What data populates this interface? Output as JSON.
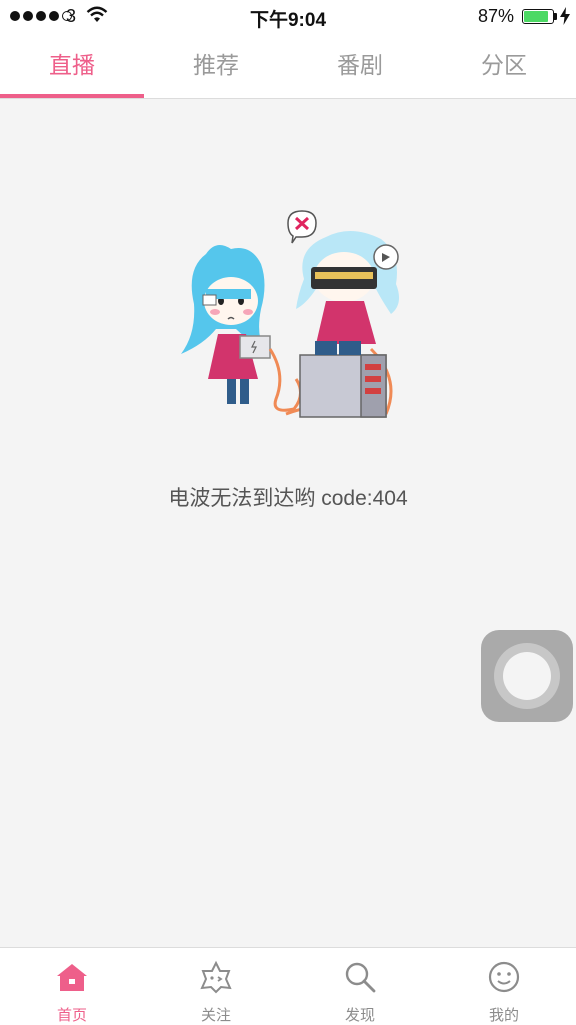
{
  "status_bar": {
    "carrier": "3",
    "time": "下午9:04",
    "battery_percent": "87%",
    "battery_level": 0.87,
    "signal_bars": 4
  },
  "top_tabs": [
    {
      "label": "直播",
      "active": true
    },
    {
      "label": "推荐",
      "active": false
    },
    {
      "label": "番剧",
      "active": false
    },
    {
      "label": "分区",
      "active": false
    }
  ],
  "content": {
    "error_message": "电波无法到达哟 code:404"
  },
  "bottom_nav": [
    {
      "label": "首页",
      "icon": "home-icon",
      "active": true
    },
    {
      "label": "关注",
      "icon": "follow-icon",
      "active": false
    },
    {
      "label": "发现",
      "icon": "search-icon",
      "active": false
    },
    {
      "label": "我的",
      "icon": "profile-icon",
      "active": false
    }
  ],
  "colors": {
    "accent": "#ee5f8a",
    "background": "#f4f4f4",
    "inactive": "#9a9a9a"
  }
}
